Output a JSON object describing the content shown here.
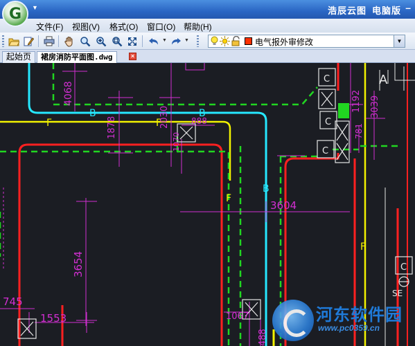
{
  "titlebar": {
    "title": "浩辰云图",
    "edition": "电脑版",
    "minimize_label": "–",
    "logo_letter": "G",
    "quick_access_icon": "caret-down-icon"
  },
  "menu": {
    "file": "文件(F)",
    "view": "视图(V)",
    "format": "格式(O)",
    "window": "窗口(O)",
    "help": "帮助(H)"
  },
  "toolbar": {
    "icons": [
      "open-folder-icon",
      "edit-icon",
      "print-icon",
      "pan-hand-icon",
      "zoom-realtime-icon",
      "zoom-in-icon",
      "zoom-window-icon",
      "zoom-extents-icon",
      "undo-icon",
      "redo-icon",
      "lightbulb-icon",
      "sun-icon",
      "lock-icon",
      "layer-color-icon"
    ],
    "layer": {
      "name": "电气报外审修改",
      "color": "#ff3000"
    }
  },
  "tabs": {
    "home": "起始页",
    "drawing": "裙房消防平面图.dwg",
    "close": "×"
  },
  "drawing": {
    "labels": {
      "b": "B",
      "f": "F",
      "c": "C",
      "se": "SE",
      "a_letter": "A",
      "d4068": "4068",
      "d1878": "1878",
      "d2030": "2030",
      "d1070": "1070",
      "d888": "888",
      "d1192": "1192",
      "d3039": "3039",
      "d781": "781",
      "d3604": "3604",
      "d3654": "3654",
      "d745": "745",
      "d1553": "1553",
      "d1067": "1067",
      "d488": "488"
    },
    "colors": {
      "background": "#1b1d23",
      "cyan": "#26e8ff",
      "yellow": "#f2f200",
      "red": "#ff2020",
      "green": "#21d621",
      "magenta": "#d12fd1",
      "white": "#e6e6e6"
    }
  },
  "watermark": {
    "name": "河东软件园",
    "url": "www.pc0359.cn"
  }
}
